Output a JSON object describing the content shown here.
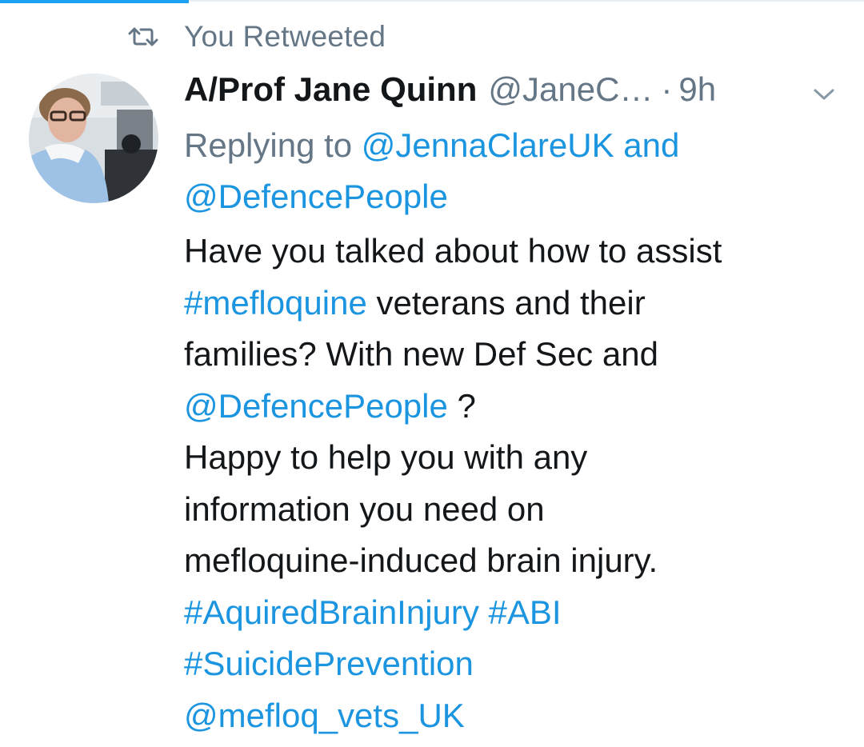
{
  "retweet": {
    "icon": "retweet-icon",
    "label": "You Retweeted"
  },
  "tweet": {
    "author_name": "A/Prof Jane Quinn",
    "handle": "@JaneC…",
    "separator": "·",
    "time": "9h",
    "menu_icon": "chevron-down-icon",
    "reply_prefix": "Replying to",
    "reply_user1": "@JennaClareUK",
    "reply_and": "and",
    "reply_user2": "@DefencePeople",
    "lines": {
      "l1": "Have you talked about how to assist",
      "l2_tag": "#mefloquine",
      "l2_text": " veterans and their",
      "l3": "families? With new Def Sec and",
      "l4_mention": "@DefencePeople",
      "l4_text": " ?",
      "l5": "Happy to help you with any",
      "l6": "information you need on",
      "l7": "mefloquine-induced brain injury.",
      "l8_tag1": "#AquiredBrainInjury",
      "l8_tag2": "#ABI",
      "l9_tag": "#SuicidePrevention",
      "l10_mention": "@mefloq_vets_UK"
    }
  },
  "colors": {
    "link": "#1b95e0",
    "muted": "#657786",
    "text": "#14171a",
    "accent": "#1da1f2"
  }
}
